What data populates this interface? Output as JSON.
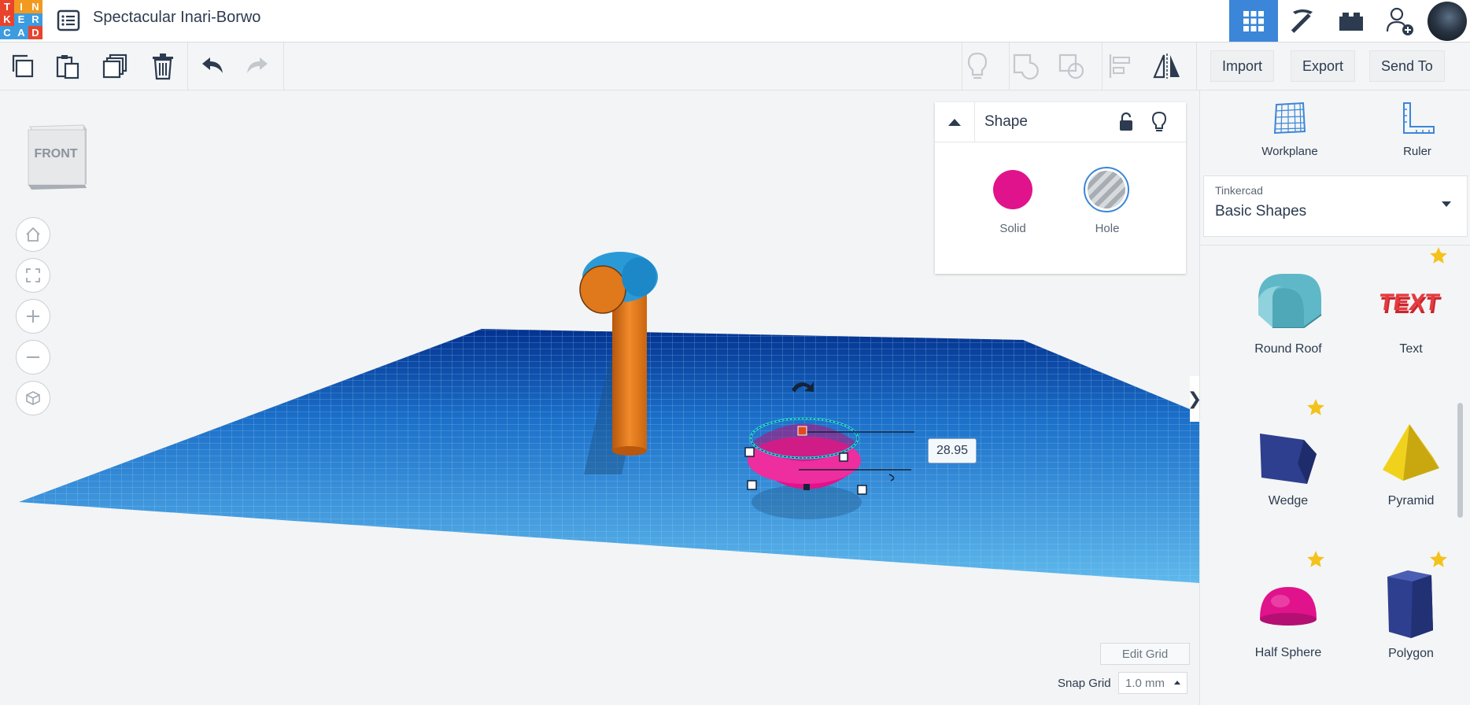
{
  "app": {
    "logo_letters": [
      "T",
      "I",
      "N",
      "K",
      "E",
      "R",
      "C",
      "A",
      "D"
    ],
    "logo_colors": [
      "#e8442d",
      "#f29a1f",
      "#f29a1f",
      "#e8442d",
      "#3d9be0",
      "#3d9be0",
      "#3d9be0",
      "#3d9be0",
      "#e8442d"
    ],
    "design_title": "Spectacular Inari-Borwo"
  },
  "topbar": {
    "buttons": [
      {
        "name": "3d-design-grid-button",
        "icon": "grid-icon",
        "active": true
      },
      {
        "name": "codeblocks-button",
        "icon": "pickaxe-icon",
        "active": false
      },
      {
        "name": "bricks-button",
        "icon": "brick-icon",
        "active": false
      },
      {
        "name": "add-user-button",
        "icon": "add-user-icon",
        "active": false
      }
    ],
    "accent_color": "#3b86d8"
  },
  "toolbar": {
    "left_tools": [
      "copy-icon",
      "paste-icon",
      "duplicate-icon",
      "delete-icon",
      "undo-icon",
      "redo-icon"
    ],
    "right_tools": [
      "note-icon",
      "group-icon",
      "ungroup-icon",
      "align-icon",
      "mirror-icon"
    ],
    "import_label": "Import",
    "export_label": "Export",
    "send_to_label": "Send To"
  },
  "viewport": {
    "viewcube_label": "FRONT",
    "nav_buttons": [
      "home-view-icon",
      "fit-all-icon",
      "zoom-in-icon",
      "zoom-out-icon",
      "perspective-icon"
    ],
    "dimension_value": "28.95",
    "edit_grid_label": "Edit Grid",
    "snap_grid_label": "Snap Grid",
    "snap_grid_value": "1.0 mm"
  },
  "shape_panel": {
    "title": "Shape",
    "solid_label": "Solid",
    "hole_label": "Hole",
    "solid_color": "#e0138c"
  },
  "sidebar": {
    "workplane_label": "Workplane",
    "ruler_label": "Ruler",
    "library_vendor": "Tinkercad",
    "library_name": "Basic Shapes",
    "shapes": [
      {
        "label": "Round Roof"
      },
      {
        "label": "Text"
      },
      {
        "label": "Wedge"
      },
      {
        "label": "Pyramid"
      },
      {
        "label": "Half Sphere"
      },
      {
        "label": "Polygon"
      }
    ]
  }
}
